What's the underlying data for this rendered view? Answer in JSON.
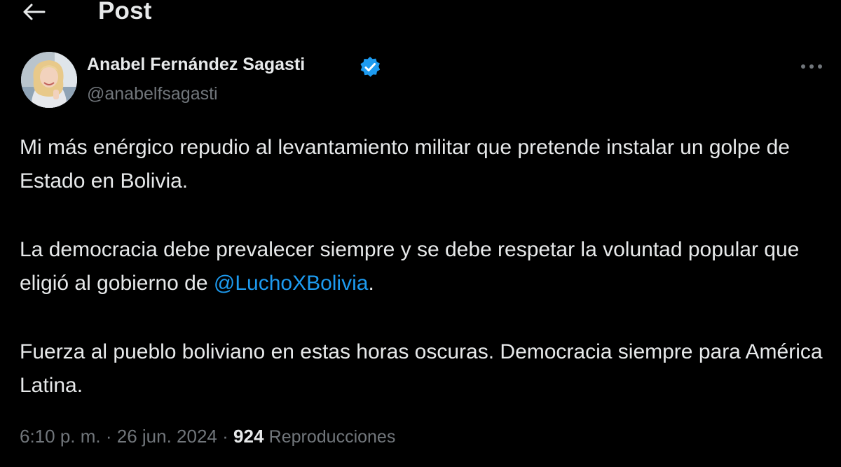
{
  "header": {
    "title": "Post",
    "back_icon": "arrow-left-icon"
  },
  "author": {
    "display_name": "Anabel Fernández Sagasti",
    "handle": "@anabelfsagasti",
    "verified_icon": "verified-badge-icon",
    "verified_color": "#1d9bf0",
    "more_icon": "more-horizontal-icon"
  },
  "post": {
    "paragraph_1": "Mi más enérgico repudio al levantamiento militar que pretende instalar un golpe de Estado en Bolivia.",
    "paragraph_2_before": "La democracia debe prevalecer siempre y se debe respetar la voluntad popular que eligió al gobierno de ",
    "paragraph_2_mention": "@LuchoXBolivia",
    "paragraph_2_after": ".",
    "paragraph_3": "Fuerza al pueblo boliviano en estas horas oscuras. Democracia siempre para América Latina."
  },
  "meta": {
    "time": "6:10 p. m.",
    "separator": "·",
    "date": "26 jun. 2024",
    "views_count": "924",
    "views_label": "Reproducciones"
  },
  "colors": {
    "background": "#000000",
    "text_primary": "#e7e9ea",
    "text_secondary": "#71767b",
    "accent": "#1d9bf0"
  }
}
